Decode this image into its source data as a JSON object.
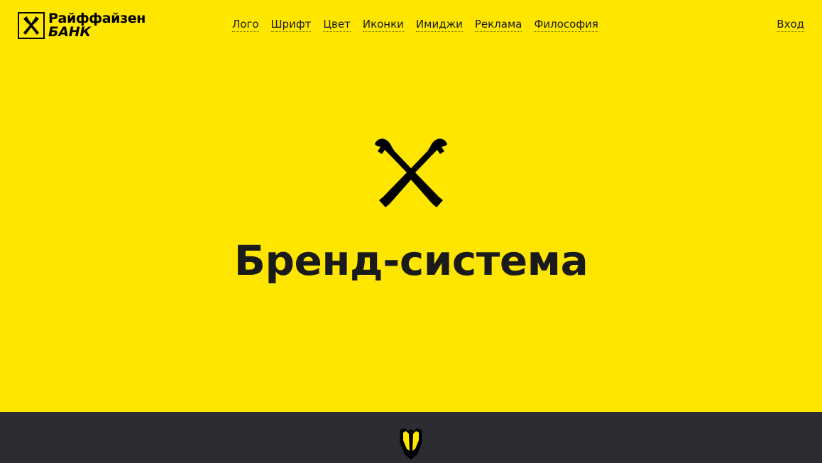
{
  "header": {
    "brand": {
      "line1": "Райффайзен",
      "line2": "БАНК"
    },
    "nav": [
      {
        "label": "Лого"
      },
      {
        "label": "Шрифт"
      },
      {
        "label": "Цвет"
      },
      {
        "label": "Иконки"
      },
      {
        "label": "Имиджи"
      },
      {
        "label": "Реклама"
      },
      {
        "label": "Философия"
      }
    ],
    "login_label": "Вход"
  },
  "hero": {
    "title": "Бренд-система",
    "logo_icon": "raiffeisen-gable-cross-icon"
  },
  "footer": {
    "icon": "shield-icon"
  },
  "colors": {
    "brand_yellow": "#fee600",
    "dark_band": "#2c2d33",
    "text": "#1a1a1a"
  }
}
